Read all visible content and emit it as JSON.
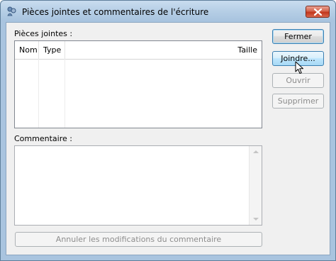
{
  "window": {
    "title": "Pièces jointes et commentaires de l'écriture"
  },
  "attachments": {
    "label": "Pièces jointes :",
    "columns": [
      "Nom",
      "Type",
      "Taille"
    ],
    "rows": []
  },
  "comment": {
    "label": "Commentaire :",
    "value": ""
  },
  "buttons": {
    "close": "Fermer",
    "attach": "Joindre...",
    "open": "Ouvrir",
    "delete": "Supprimer",
    "cancel_comment": "Annuler les modifications du commentaire"
  },
  "icons": {
    "title": "attachment-people-icon",
    "close": "close-icon",
    "cursor": "mouse-cursor-icon"
  },
  "colors": {
    "close_button": "#c2361c",
    "default_border": "#3c7fb1",
    "disabled_text": "#8d8d8d"
  }
}
